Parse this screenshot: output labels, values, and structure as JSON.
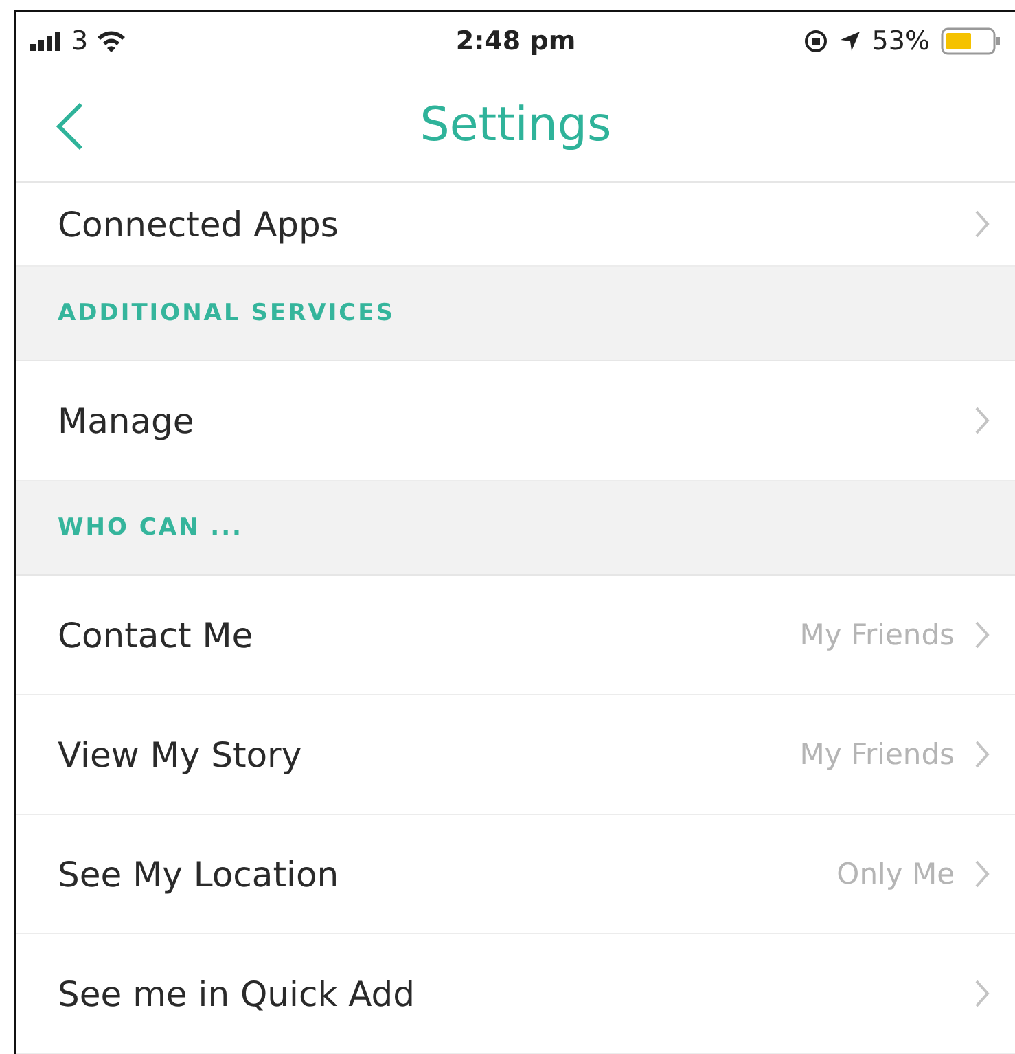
{
  "status_bar": {
    "carrier": "3",
    "time": "2:48 pm",
    "battery": "53%"
  },
  "nav": {
    "title": "Settings"
  },
  "items": [
    {
      "kind": "row",
      "label": "Connected Apps"
    },
    {
      "kind": "header",
      "label": "ADDITIONAL SERVICES"
    },
    {
      "kind": "row",
      "label": "Manage"
    },
    {
      "kind": "header",
      "label": "WHO CAN ..."
    },
    {
      "kind": "row",
      "label": "Contact Me",
      "value": "My Friends"
    },
    {
      "kind": "row",
      "label": "View My Story",
      "value": "My Friends"
    },
    {
      "kind": "row",
      "label": "See My Location",
      "value": "Only Me"
    },
    {
      "kind": "row",
      "label": "See me in Quick Add"
    }
  ]
}
